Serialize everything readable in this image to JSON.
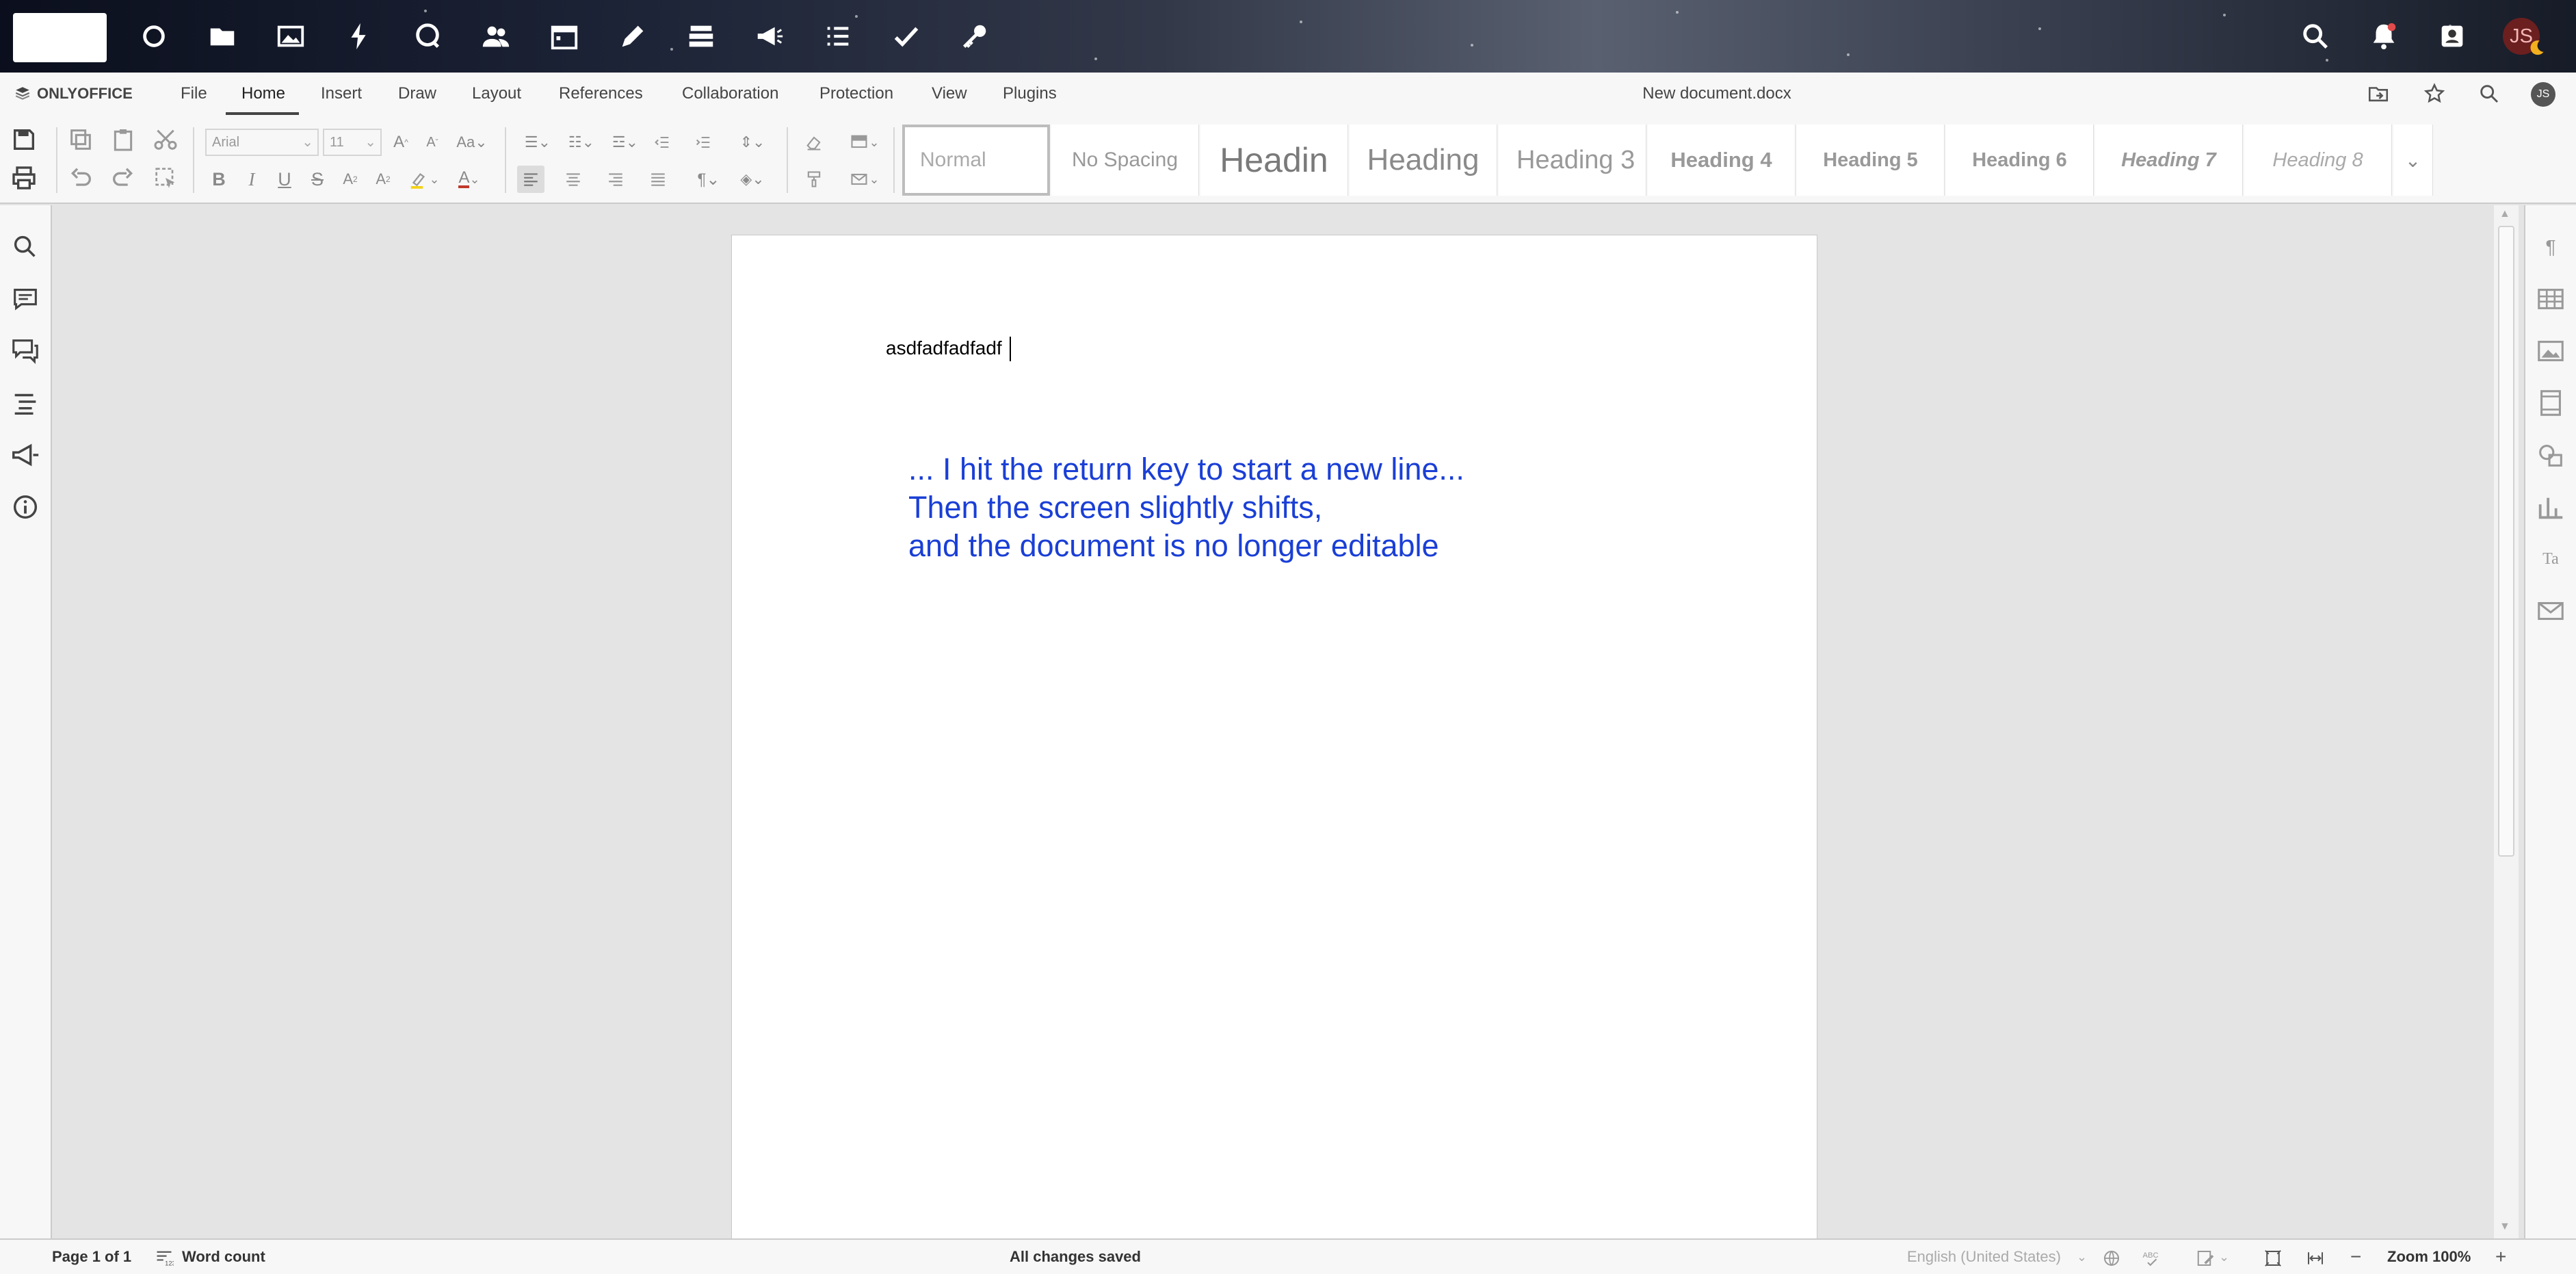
{
  "topbar": {
    "icons": [
      "circle-icon",
      "folder-icon",
      "image-icon",
      "activity-icon",
      "talk-icon",
      "contacts-icon",
      "calendar-icon",
      "pencil-icon",
      "deck-icon",
      "announcements-icon",
      "tasks-icon",
      "checkmark-icon",
      "key-icon",
      "search-icon",
      "notifications-icon",
      "user-menu-icon"
    ],
    "avatar_initials": "JS"
  },
  "menubar": {
    "brand": "ONLYOFFICE",
    "items": [
      "File",
      "Home",
      "Insert",
      "Draw",
      "Layout",
      "References",
      "Collaboration",
      "Protection",
      "View",
      "Plugins"
    ],
    "active": "Home",
    "document_title": "New document.docx",
    "user_initials": "JS"
  },
  "toolbar": {
    "font_name": "Arial",
    "font_size": "11",
    "styles": [
      "Normal",
      "No Spacing",
      "Headin",
      "Heading",
      "Heading 3",
      "Heading 4",
      "Heading 5",
      "Heading 6",
      "Heading 7",
      "Heading 8"
    ],
    "selected_style": "Normal"
  },
  "document": {
    "body_text": "asdfadfadfadf",
    "annotation_lines": [
      "... I hit the return key to start a new line...",
      "Then the screen slightly shifts,",
      "and the document is no longer editable"
    ],
    "annotation_color": "#1a3fd6"
  },
  "statusbar": {
    "page_info": "Page 1 of 1",
    "word_count": "Word count",
    "save_status": "All changes saved",
    "language": "English (United States)",
    "zoom": "Zoom 100%"
  }
}
